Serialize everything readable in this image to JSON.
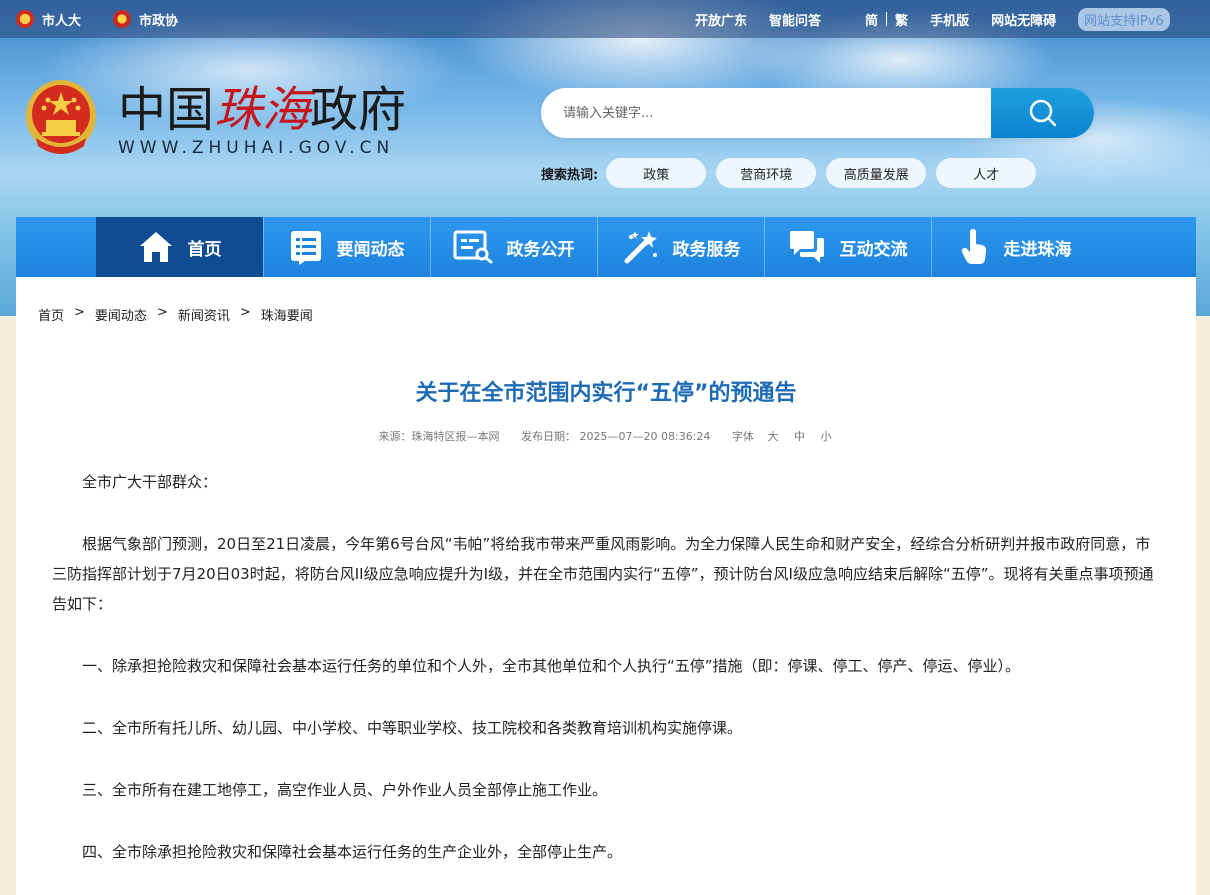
{
  "topbar": {
    "npc": "市人大",
    "cppcc": "市政协",
    "links": [
      "开放广东",
      "智能问答"
    ],
    "simplified": "简",
    "traditional": "繁",
    "mobile": "手机版",
    "accessibility": "网站无障碍",
    "ipv6": "网站支持IPv6"
  },
  "logo": {
    "title_part1": "中国",
    "title_red": "珠海",
    "title_part2": "政府",
    "url": "WWW.ZHUHAI.GOV.CN"
  },
  "search": {
    "placeholder": "请输入关键字...",
    "hot_label": "搜索热词:",
    "hot_tags": [
      "政策",
      "营商环境",
      "高质量发展",
      "人才"
    ]
  },
  "nav": {
    "items": [
      "首页",
      "要闻动态",
      "政务公开",
      "政务服务",
      "互动交流",
      "走进珠海"
    ]
  },
  "breadcrumb": [
    "首页",
    "要闻动态",
    "新闻资讯",
    "珠海要闻"
  ],
  "article": {
    "title": "关于在全市范围内实行“五停”的预通告",
    "source": "来源：珠海特区报—本网",
    "date": "发布日期：  2025—07—20 08:36:24",
    "font_label": "字体",
    "font_large": "大",
    "font_medium": "中",
    "font_small": "小",
    "paragraphs": [
      "全市广大干部群众：",
      "根据气象部门预测，20日至21日凌晨，今年第6号台风“韦帕”将给我市带来严重风雨影响。为全力保障人民生命和财产安全，经综合分析研判并报市政府同意，市三防指挥部计划于7月20日03时起，将防台风II级应急响应提升为I级，并在全市范围内实行“五停”，预计防台风I级应急响应结束后解除“五停”。现将有关重点事项预通告如下：",
      "一、除承担抢险救灾和保障社会基本运行任务的单位和个人外，全市其他单位和个人执行“五停”措施（即：停课、停工、停产、停运、停业）。",
      "二、全市所有托儿所、幼儿园、中小学校、中等职业学校、技工院校和各类教育培训机构实施停课。",
      "三、全市所有在建工地停工，高空作业人员、户外作业人员全部停止施工作业。",
      "四、全市除承担抢险救灾和保障社会基本运行任务的生产企业外，全部停止生产。"
    ]
  }
}
